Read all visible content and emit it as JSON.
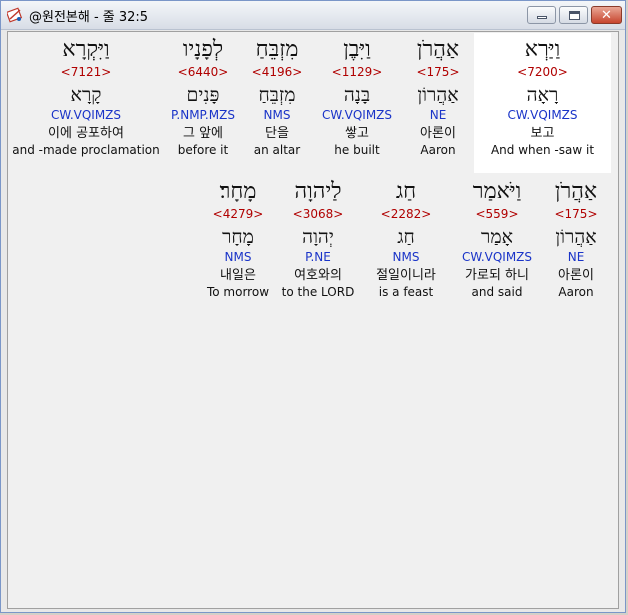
{
  "window": {
    "title": "@원전본해 - 줄 32:5",
    "close_glyph": "✕"
  },
  "rows": [
    {
      "words": [
        {
          "heb": "וַיַּרְא",
          "num": "<7200>",
          "lemma": "רָאָה",
          "morph": "CW.VQIMZS",
          "kor": "보고",
          "eng": "And when -saw it"
        },
        {
          "heb": "אַהֲרֹן",
          "num": "<175>",
          "lemma": "אַהֲרוֹן",
          "morph": "NE",
          "kor": "아론이",
          "eng": "Aaron"
        },
        {
          "heb": "וַיִּבֶן",
          "num": "<1129>",
          "lemma": "בָּנָה",
          "morph": "CW.VQIMZS",
          "kor": "쌓고",
          "eng": "he built"
        },
        {
          "heb": "מִזְבֵּחַ",
          "num": "<4196>",
          "lemma": "מִזְבֵּחַ",
          "morph": "NMS",
          "kor": "단을",
          "eng": "an altar"
        },
        {
          "heb": "לְפָנָיו",
          "num": "<6440>",
          "lemma": "פָּנִים",
          "morph": "P.NMP.MZS",
          "kor": "그 앞에",
          "eng": "before it"
        },
        {
          "heb": "וַיִּקְרָא",
          "num": "<7121>",
          "lemma": "קָרָא",
          "morph": "CW.VQIMZS",
          "kor": "이에 공포하여",
          "eng": "and -made proclamation"
        }
      ]
    },
    {
      "words": [
        {
          "heb": "אַהֲרֹן",
          "num": "<175>",
          "lemma": "אַהֲרוֹן",
          "morph": "NE",
          "kor": "아론이",
          "eng": "Aaron"
        },
        {
          "heb": "וַיֹּאמַר",
          "num": "<559>",
          "lemma": "אָמַר",
          "morph": "CW.VQIMZS",
          "kor": "가로되 하니",
          "eng": "and said"
        },
        {
          "heb": "חַג",
          "num": "<2282>",
          "lemma": "חַג",
          "morph": "NMS",
          "kor": "절일이니라",
          "eng": "is a feast"
        },
        {
          "heb": "לַיהוָה",
          "num": "<3068>",
          "lemma": "יְהוָה",
          "morph": "P.NE",
          "kor": "여호와의",
          "eng": "to the LORD"
        },
        {
          "heb": "מָחָר׃",
          "num": "<4279>",
          "lemma": "מָחָר",
          "morph": "NMS",
          "kor": "내일은",
          "eng": "To morrow"
        }
      ]
    }
  ]
}
